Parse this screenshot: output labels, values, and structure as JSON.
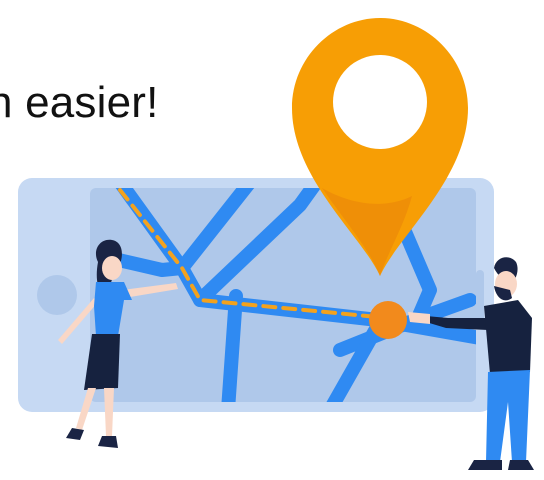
{
  "headline": {
    "text": "h easier!"
  },
  "illustration": {
    "subject": "map-navigation",
    "icons": [
      "location-pin-icon",
      "phone-map-icon"
    ],
    "colors": {
      "pin": "#F79E05",
      "pin_shadow": "#E9840A",
      "phone_frame": "#C6D9F3",
      "map_bg": "#AFC8EA",
      "road": "#2F8AF2",
      "route_dash": "#F3A21E",
      "destination_dot": "#F28A1C",
      "skin": "#F9D7C6",
      "hair": "#1A2444",
      "woman_top": "#2F8AF2",
      "woman_skirt": "#16223F",
      "man_sweater": "#16223F",
      "man_jeans": "#2F8AF2"
    }
  }
}
